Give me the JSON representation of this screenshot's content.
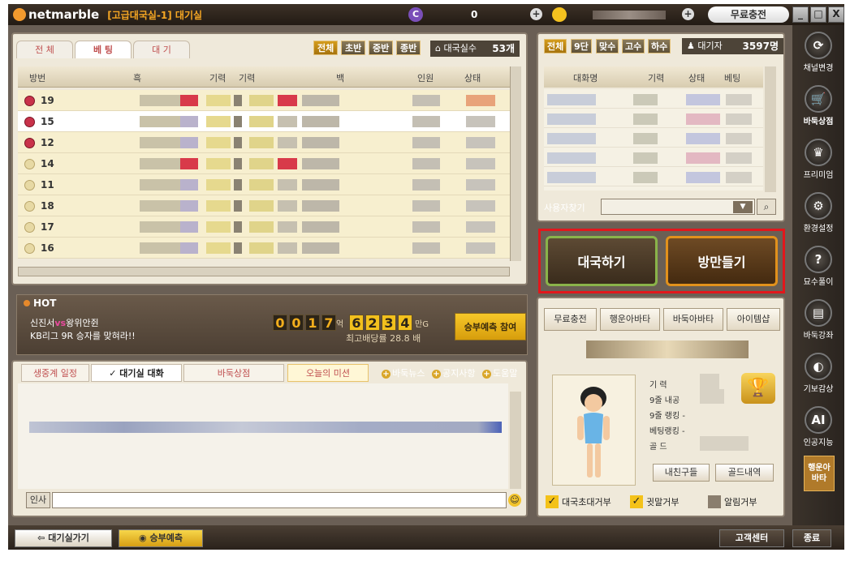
{
  "titlebar": {
    "app_name": "netmarble",
    "room": "[고급대국실-1] 대기실",
    "coin_symbol": "C",
    "balance": "0",
    "charge_label": "무료충전",
    "win_minimize": "_",
    "win_maximize": "□",
    "win_close": "X"
  },
  "room_list": {
    "tabs": [
      "전 체",
      "베 팅",
      "대 기"
    ],
    "filters": [
      "전체",
      "초반",
      "중반",
      "종반"
    ],
    "count_label": "대국실수",
    "count_value": "53개",
    "columns": [
      "방번",
      "흑",
      "기력",
      "기력",
      "백",
      "인원",
      "상태"
    ],
    "rows": [
      {
        "no": "19",
        "badge": "red"
      },
      {
        "no": "15",
        "badge": "red"
      },
      {
        "no": "12",
        "badge": "red"
      },
      {
        "no": "14",
        "badge": "yellow"
      },
      {
        "no": "11",
        "badge": "yellow"
      },
      {
        "no": "18",
        "badge": "yellow"
      },
      {
        "no": "17",
        "badge": "yellow"
      },
      {
        "no": "16",
        "badge": "yellow"
      }
    ]
  },
  "user_list": {
    "filters": [
      "전체",
      "9단",
      "맞수",
      "고수",
      "하수"
    ],
    "waiting_label": "대기자",
    "waiting_value": "3597명",
    "columns": [
      "대화명",
      "기력",
      "상태",
      "베팅"
    ],
    "search_label": "사용자찾기"
  },
  "actions": {
    "play_label": "대국하기",
    "make_room_label": "방만들기"
  },
  "hot": {
    "title": "HOT",
    "match_left": "신진서",
    "vs": "vs",
    "match_right": "왕위안쥔",
    "subtitle": "KB리그 9R 승자를 맞혀라!!",
    "digits_a": [
      "0",
      "0",
      "1",
      "7"
    ],
    "unit_a": "억",
    "digits_b": [
      "6",
      "2",
      "3",
      "4"
    ],
    "unit_b": "만G",
    "rate": "최고배당률 28.8 배",
    "button": "승부예측 참여"
  },
  "chat": {
    "tabs": [
      "생중계 일정",
      "✓ 대기실 대화",
      "바둑상점",
      "오늘의 미션"
    ],
    "links": [
      "바둑뉴스",
      "공지사항",
      "도움말"
    ],
    "input_label": "인사"
  },
  "shop": {
    "buttons": [
      "무료충전",
      "행운아바타",
      "바둑아바타",
      "아이템샵"
    ]
  },
  "profile": {
    "stats": [
      "기 력",
      "9줄 내공",
      "9줄 랭킹 -",
      "베팅랭킹 -",
      "골 드"
    ],
    "friend_btn": "내친구들",
    "gold_btn": "골드내역"
  },
  "checks": [
    {
      "label": "대국초대거부",
      "on": true
    },
    {
      "label": "귓말거부",
      "on": true
    },
    {
      "label": "알림거부",
      "on": false
    }
  ],
  "nav": {
    "items": [
      "채널변경",
      "바둑상점",
      "프리미엄",
      "환경설정",
      "묘수풀이",
      "바둑강좌",
      "기보감상",
      "인공지능"
    ],
    "highlight": "행운아바타"
  },
  "bottom": {
    "back_label": "대기실가기",
    "predict_label": "승부예측",
    "support_label": "고객센터",
    "exit_label": "종료"
  }
}
